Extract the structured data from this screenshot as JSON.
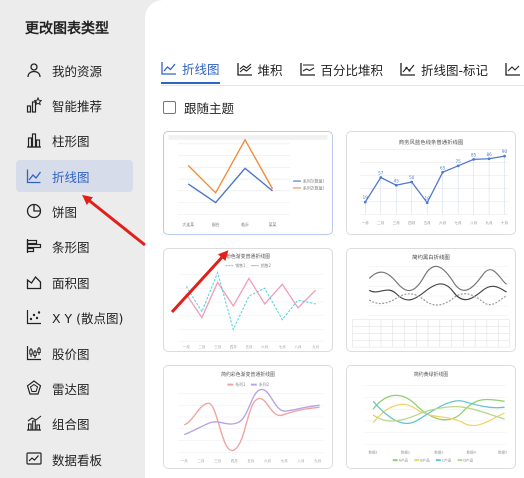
{
  "dialog": {
    "title": "更改图表类型"
  },
  "sidebar": {
    "items": [
      {
        "label": "我的资源",
        "icon": "person-icon"
      },
      {
        "label": "智能推荐",
        "icon": "recommend-icon"
      },
      {
        "label": "柱形图",
        "icon": "column-chart-icon"
      },
      {
        "label": "折线图",
        "icon": "line-chart-icon",
        "active": true
      },
      {
        "label": "饼图",
        "icon": "pie-chart-icon"
      },
      {
        "label": "条形图",
        "icon": "bar-chart-icon"
      },
      {
        "label": "面积图",
        "icon": "area-chart-icon"
      },
      {
        "label": "X Y (散点图)",
        "icon": "scatter-chart-icon"
      },
      {
        "label": "股价图",
        "icon": "stock-chart-icon"
      },
      {
        "label": "雷达图",
        "icon": "radar-chart-icon"
      },
      {
        "label": "组合图",
        "icon": "combo-chart-icon"
      },
      {
        "label": "数据看板",
        "icon": "dashboard-icon"
      }
    ]
  },
  "tabs": [
    {
      "label": "折线图",
      "active": true
    },
    {
      "label": "堆积"
    },
    {
      "label": "百分比堆积"
    },
    {
      "label": "折线图-标记"
    }
  ],
  "follow_theme": {
    "label": "跟随主题",
    "checked": false
  },
  "templates": {
    "card1": {
      "categories": [
        "大连某",
        "烟台",
        "临沂",
        "某某"
      ],
      "legend": [
        "系列1(数量)",
        "系列2(数量)"
      ]
    },
    "card2": {
      "title": "商务风蓝色线条普通折线图",
      "values": [
        19,
        57,
        45,
        50,
        18,
        65,
        75,
        85,
        86,
        90
      ],
      "categories": [
        "一月",
        "二月",
        "三月",
        "四月",
        "五月",
        "六月",
        "七月",
        "八月",
        "九月",
        "十月"
      ]
    },
    "card3": {
      "title": "粉色渐变普通折线图",
      "legend": [
        "销售1",
        "销售2"
      ],
      "categories": [
        "一月",
        "二月",
        "三月",
        "四月",
        "五月",
        "六月",
        "七月",
        "八月",
        "九月"
      ]
    },
    "card4": {
      "title": "简约黑白折线图"
    },
    "card5": {
      "title": "简约彩色渐变普通折线图",
      "legend": [
        "系列1",
        "系列2"
      ],
      "categories": [
        "一月",
        "二月",
        "三月",
        "四月",
        "五月",
        "六月",
        "七月",
        "八月",
        "九月"
      ]
    },
    "card6": {
      "title": "简约黄绿折线图",
      "legend": [
        "A产品",
        "B产品",
        "C产品",
        "D产品"
      ],
      "categories": [
        "数据1",
        "数据2",
        "数据3",
        "数据4",
        "数据5"
      ]
    }
  },
  "colors": {
    "accent": "#2f63c5",
    "arrow": "#e0201b",
    "active_bg": "#d7dcea"
  }
}
